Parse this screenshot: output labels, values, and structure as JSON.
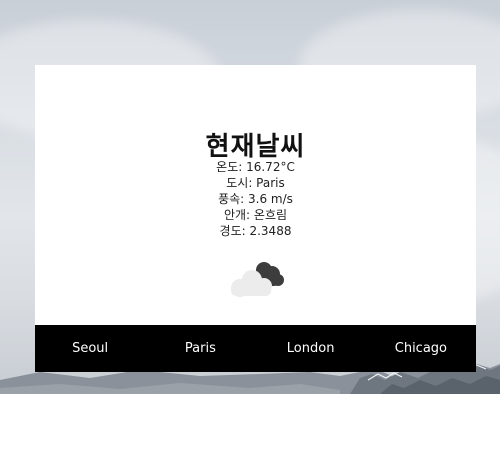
{
  "header": {
    "title": "현재날씨"
  },
  "weather": {
    "temperature": "온도: 16.72°C",
    "city": "도시: Paris",
    "wind": "풍속: 3.6 m/s",
    "condition": "안개: 온흐림",
    "longitude": "경도: 2.3488",
    "icon": "cloud-icon"
  },
  "nav": {
    "items": [
      {
        "label": "Seoul"
      },
      {
        "label": "Paris"
      },
      {
        "label": "London"
      },
      {
        "label": "Chicago"
      }
    ]
  },
  "colors": {
    "nav_background": "#000000",
    "nav_text": "#ffffff",
    "card_background": "#ffffff"
  }
}
